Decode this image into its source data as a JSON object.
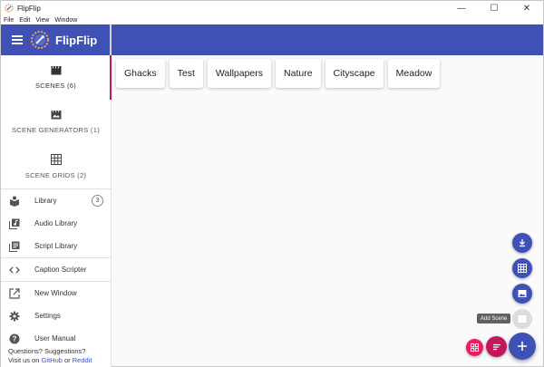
{
  "window": {
    "title": "FlipFlip",
    "controls": {
      "minimize": "—",
      "maximize": "☐",
      "close": "✕"
    }
  },
  "menu": [
    "File",
    "Edit",
    "View",
    "Window"
  ],
  "header": {
    "brand": "FlipFlip"
  },
  "sidebar": {
    "sections": [
      {
        "label": "SCENES (6)",
        "icon": "movie-clapper-icon"
      },
      {
        "label": "SCENE GENERATORS (1)",
        "icon": "scene-generator-icon"
      },
      {
        "label": "SCENE GRIDS (2)",
        "icon": "grid-icon"
      }
    ],
    "items": [
      {
        "label": "Library",
        "icon": "library-icon",
        "badge": "3"
      },
      {
        "label": "Audio Library",
        "icon": "audio-library-icon"
      },
      {
        "label": "Script Library",
        "icon": "script-library-icon"
      },
      {
        "label": "Caption Scripter",
        "icon": "code-icon"
      },
      {
        "label": "New Window",
        "icon": "open-in-new-icon"
      },
      {
        "label": "Settings",
        "icon": "gear-icon"
      },
      {
        "label": "User Manual",
        "icon": "help-icon"
      }
    ],
    "footer": {
      "line1": "Questions? Suggestions?",
      "prefix": "Visit us on ",
      "link1": "GitHub",
      "mid": " or ",
      "link2": "Reddit"
    }
  },
  "scenes": [
    "Ghacks",
    "Test",
    "Wallpapers",
    "Nature",
    "Cityscape",
    "Meadow"
  ],
  "fab": {
    "tooltip": "Add Scene"
  },
  "colors": {
    "primary": "#3f51b5",
    "accent": "#c2185b",
    "accent_light": "#e91e63"
  }
}
